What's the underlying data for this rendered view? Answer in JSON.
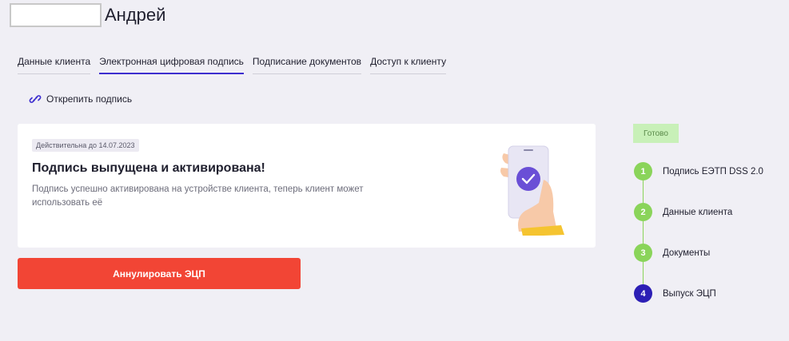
{
  "client": {
    "name": "Андрей"
  },
  "tabs": [
    {
      "label": "Данные клиента"
    },
    {
      "label": "Электронная цифровая подпись"
    },
    {
      "label": "Подписание документов"
    },
    {
      "label": "Доступ к клиенту"
    }
  ],
  "active_tab": "Электронная цифровая подпись",
  "unpin": {
    "label": "Открепить подпись",
    "icon": "link-icon"
  },
  "card": {
    "badge": "Действительна до 14.07.2023",
    "title": "Подпись выпущена и активирована!",
    "description": "Подпись успешно активирована на устройстве клиента, теперь клиент может использовать её"
  },
  "annul_button": {
    "label": "Аннулировать ЭЦП"
  },
  "status": {
    "label": "Готово"
  },
  "steps": [
    {
      "number": "1",
      "label": "Подпись ЕЭТП DSS 2.0",
      "state": "done"
    },
    {
      "number": "2",
      "label": "Данные клиента",
      "state": "done"
    },
    {
      "number": "3",
      "label": "Документы",
      "state": "done"
    },
    {
      "number": "4",
      "label": "Выпуск ЭЦП",
      "state": "current"
    }
  ],
  "colors": {
    "accent": "#3d2ecf",
    "danger": "#f24535",
    "success": "#8ad45a",
    "current_step": "#2c1fb5"
  }
}
